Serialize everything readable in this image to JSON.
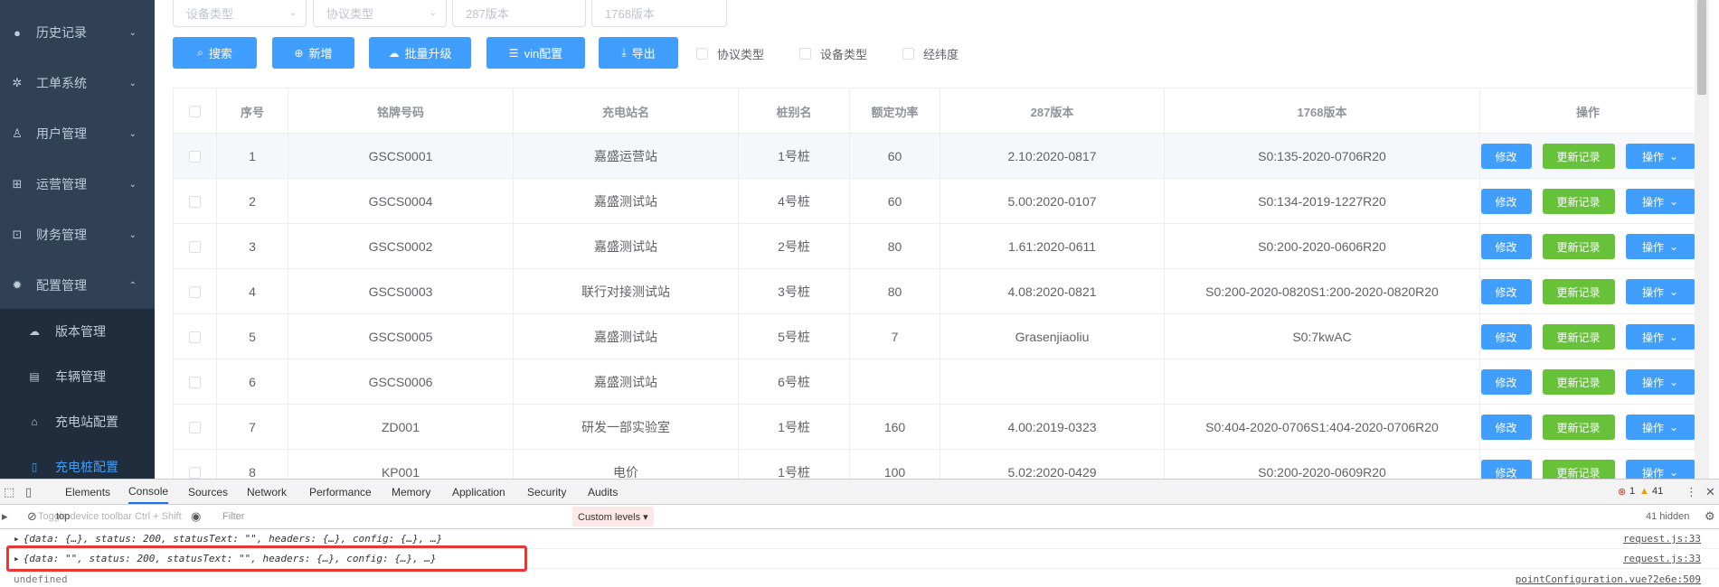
{
  "sidebar": {
    "items": [
      {
        "label": "历史记录",
        "icon": "clock-icon",
        "arrow": "⌄"
      },
      {
        "label": "工单系统",
        "icon": "gear-icon",
        "arrow": "⌄"
      },
      {
        "label": "用户管理",
        "icon": "user-icon",
        "arrow": "⌄"
      },
      {
        "label": "运营管理",
        "icon": "operation-icon",
        "arrow": "⌄"
      },
      {
        "label": "财务管理",
        "icon": "finance-icon",
        "arrow": "⌄"
      },
      {
        "label": "配置管理",
        "icon": "settings-icon",
        "arrow": "⌃"
      }
    ],
    "subitems": [
      {
        "label": "版本管理",
        "icon": "cloud-upload-icon"
      },
      {
        "label": "车辆管理",
        "icon": "bus-icon"
      },
      {
        "label": "充电站配置",
        "icon": "station-icon"
      },
      {
        "label": "充电桩配置",
        "icon": "charger-icon"
      }
    ]
  },
  "filters": {
    "device_type": "设备类型",
    "protocol_type": "协议类型",
    "v287": "287版本",
    "v1768": "1768版本"
  },
  "toolbar": {
    "search": "搜索",
    "add": "新增",
    "batch_upgrade": "批量升级",
    "vin_config": "vin配置",
    "export": "导出",
    "chk_protocol": "协议类型",
    "chk_device": "设备类型",
    "chk_latlng": "经纬度"
  },
  "table": {
    "headers": [
      "序号",
      "铭牌号码",
      "充电站名",
      "桩别名",
      "额定功率",
      "287版本",
      "1768版本",
      "操作"
    ],
    "rows": [
      {
        "no": "1",
        "plate": "GSCS0001",
        "station": "嘉盛运营站",
        "alias": "1号桩",
        "power": "60",
        "v287": "2.10:2020-0817",
        "v1768": "S0:135-2020-0706R20"
      },
      {
        "no": "2",
        "plate": "GSCS0004",
        "station": "嘉盛测试站",
        "alias": "4号桩",
        "power": "60",
        "v287": "5.00:2020-0107",
        "v1768": "S0:134-2019-1227R20"
      },
      {
        "no": "3",
        "plate": "GSCS0002",
        "station": "嘉盛测试站",
        "alias": "2号桩",
        "power": "80",
        "v287": "1.61:2020-0611",
        "v1768": "S0:200-2020-0606R20"
      },
      {
        "no": "4",
        "plate": "GSCS0003",
        "station": "联行对接测试站",
        "alias": "3号桩",
        "power": "80",
        "v287": "4.08:2020-0821",
        "v1768": "S0:200-2020-0820S1:200-2020-0820R20"
      },
      {
        "no": "5",
        "plate": "GSCS0005",
        "station": "嘉盛测试站",
        "alias": "5号桩",
        "power": "7",
        "v287": "Grasenjiaoliu",
        "v1768": "S0:7kwAC"
      },
      {
        "no": "6",
        "plate": "GSCS0006",
        "station": "嘉盛测试站",
        "alias": "6号桩",
        "power": "",
        "v287": "",
        "v1768": ""
      },
      {
        "no": "7",
        "plate": "ZD001",
        "station": "研发一部实验室",
        "alias": "1号桩",
        "power": "160",
        "v287": "4.00:2019-0323",
        "v1768": "S0:404-2020-0706S1:404-2020-0706R20"
      },
      {
        "no": "8",
        "plate": "KP001",
        "station": "电价",
        "alias": "1号桩",
        "power": "100",
        "v287": "5.02:2020-0429",
        "v1768": "S0:200-2020-0609R20"
      }
    ],
    "op_edit": "修改",
    "op_record": "更新记录",
    "op_more": "操作"
  },
  "devtools": {
    "tabs": [
      "Elements",
      "Console",
      "Sources",
      "Network",
      "Performance",
      "Memory",
      "Application",
      "Security",
      "Audits"
    ],
    "error_count": "1",
    "warning_count": "41",
    "context": "top",
    "toggle_tooltip": "Toggle device toolbar  Ctrl + Shift",
    "filter_placeholder": "Filter",
    "levels": "Custom levels ▾",
    "hidden": "41 hidden",
    "logs": [
      {
        "text": "{data: {…}, status: 200, statusText: \"\", headers: {…}, config: {…}, …}",
        "source": "request.js:33"
      },
      {
        "text": "{data: \"\", status: 200, statusText: \"\", headers: {…}, config: {…}, …}",
        "source": "request.js:33"
      },
      {
        "text": "undefined",
        "source": "pointConfiguration.vue?2e6e:509"
      }
    ]
  },
  "colors": {
    "primary": "#409eff",
    "success": "#67c23a",
    "sidebar": "#304156",
    "highlight": "#e53935"
  }
}
